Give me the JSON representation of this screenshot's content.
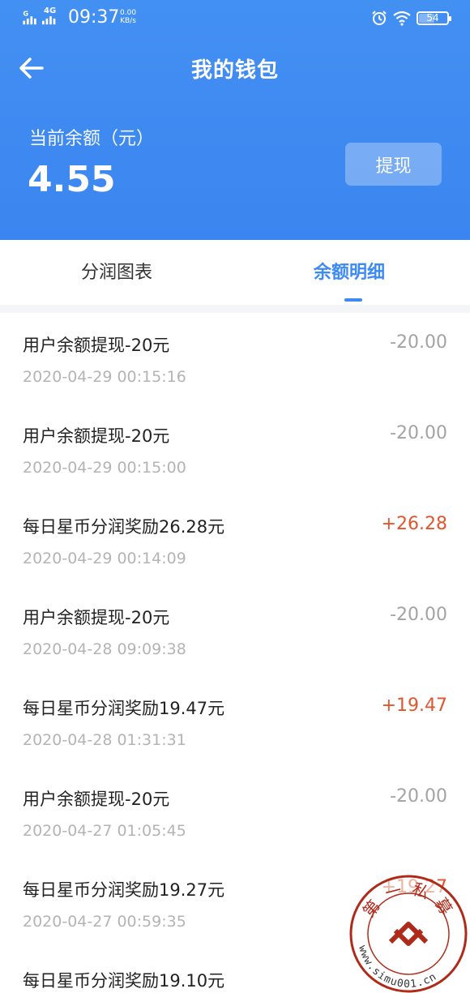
{
  "status_bar": {
    "network_label": "4G",
    "time": "09:37",
    "speed_value": "0.00",
    "speed_unit": "KB/s",
    "battery": "54"
  },
  "header": {
    "title": "我的钱包",
    "balance_label": "当前余额（元）",
    "balance_value": "4.55",
    "withdraw_label": "提现"
  },
  "tabs": [
    {
      "label": "分润图表",
      "active": false
    },
    {
      "label": "余额明细",
      "active": true
    }
  ],
  "transactions": [
    {
      "title": "用户余额提现-20元",
      "time": "2020-04-29 00:15:16",
      "amount": "-20.00"
    },
    {
      "title": "用户余额提现-20元",
      "time": "2020-04-29 00:15:00",
      "amount": "-20.00"
    },
    {
      "title": "每日星币分润奖励26.28元",
      "time": "2020-04-29 00:14:09",
      "amount": "+26.28"
    },
    {
      "title": "用户余额提现-20元",
      "time": "2020-04-28 09:09:38",
      "amount": "-20.00"
    },
    {
      "title": "每日星币分润奖励19.47元",
      "time": "2020-04-28 01:31:31",
      "amount": "+19.47"
    },
    {
      "title": "用户余额提现-20元",
      "time": "2020-04-27 01:05:45",
      "amount": "-20.00"
    },
    {
      "title": "每日星币分润奖励19.27元",
      "time": "2020-04-27 00:59:35",
      "amount": "+19.27"
    },
    {
      "title": "每日星币分润奖励19.10元",
      "time": "",
      "amount": ""
    }
  ],
  "watermark": {
    "top_text": "第一私募",
    "url_text": "www.simu001.cn"
  },
  "colors": {
    "header_blue": "#3b85f0",
    "tab_active": "#3d8bf2",
    "amount_positive": "#e0562e",
    "amount_negative": "#a3a3a3"
  }
}
